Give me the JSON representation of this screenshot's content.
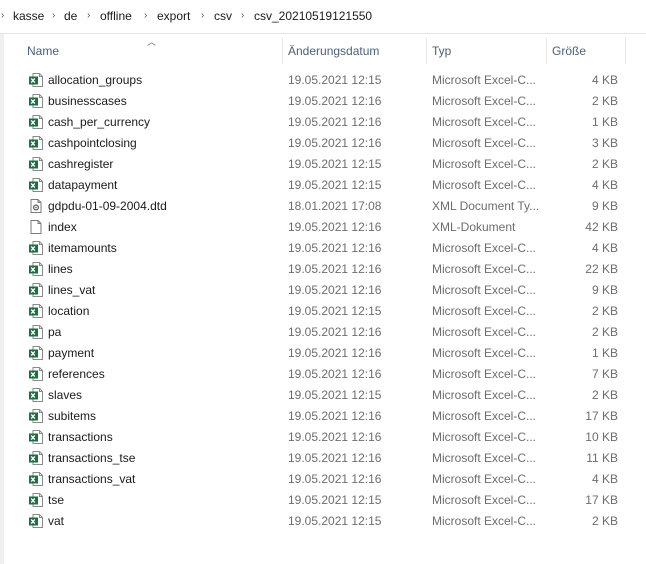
{
  "breadcrumb": [
    "kasse",
    "de",
    "offline",
    "export",
    "csv",
    "csv_20210519121550"
  ],
  "columns": {
    "name": "Name",
    "date": "Änderungsdatum",
    "type": "Typ",
    "size": "Größe"
  },
  "colors": {
    "excel_green": "#1d6f42",
    "header_text": "#4c607a",
    "secondary_text": "#6d6d6d"
  },
  "files": [
    {
      "name": "allocation_groups",
      "date": "19.05.2021 12:15",
      "type": "Microsoft Excel-C...",
      "size": "4 KB",
      "icon": "excel-csv-icon"
    },
    {
      "name": "businesscases",
      "date": "19.05.2021 12:16",
      "type": "Microsoft Excel-C...",
      "size": "2 KB",
      "icon": "excel-csv-icon"
    },
    {
      "name": "cash_per_currency",
      "date": "19.05.2021 12:16",
      "type": "Microsoft Excel-C...",
      "size": "1 KB",
      "icon": "excel-csv-icon"
    },
    {
      "name": "cashpointclosing",
      "date": "19.05.2021 12:16",
      "type": "Microsoft Excel-C...",
      "size": "3 KB",
      "icon": "excel-csv-icon"
    },
    {
      "name": "cashregister",
      "date": "19.05.2021 12:15",
      "type": "Microsoft Excel-C...",
      "size": "2 KB",
      "icon": "excel-csv-icon"
    },
    {
      "name": "datapayment",
      "date": "19.05.2021 12:15",
      "type": "Microsoft Excel-C...",
      "size": "4 KB",
      "icon": "excel-csv-icon"
    },
    {
      "name": "gdpdu-01-09-2004.dtd",
      "date": "18.01.2021 17:08",
      "type": "XML Document Ty...",
      "size": "9 KB",
      "icon": "dtd-file-icon"
    },
    {
      "name": "index",
      "date": "19.05.2021 12:16",
      "type": "XML-Dokument",
      "size": "42 KB",
      "icon": "blank-file-icon"
    },
    {
      "name": "itemamounts",
      "date": "19.05.2021 12:16",
      "type": "Microsoft Excel-C...",
      "size": "4 KB",
      "icon": "excel-csv-icon"
    },
    {
      "name": "lines",
      "date": "19.05.2021 12:16",
      "type": "Microsoft Excel-C...",
      "size": "22 KB",
      "icon": "excel-csv-icon"
    },
    {
      "name": "lines_vat",
      "date": "19.05.2021 12:16",
      "type": "Microsoft Excel-C...",
      "size": "9 KB",
      "icon": "excel-csv-icon"
    },
    {
      "name": "location",
      "date": "19.05.2021 12:15",
      "type": "Microsoft Excel-C...",
      "size": "2 KB",
      "icon": "excel-csv-icon"
    },
    {
      "name": "pa",
      "date": "19.05.2021 12:16",
      "type": "Microsoft Excel-C...",
      "size": "2 KB",
      "icon": "excel-csv-icon"
    },
    {
      "name": "payment",
      "date": "19.05.2021 12:16",
      "type": "Microsoft Excel-C...",
      "size": "1 KB",
      "icon": "excel-csv-icon"
    },
    {
      "name": "references",
      "date": "19.05.2021 12:16",
      "type": "Microsoft Excel-C...",
      "size": "7 KB",
      "icon": "excel-csv-icon"
    },
    {
      "name": "slaves",
      "date": "19.05.2021 12:15",
      "type": "Microsoft Excel-C...",
      "size": "2 KB",
      "icon": "excel-csv-icon"
    },
    {
      "name": "subitems",
      "date": "19.05.2021 12:16",
      "type": "Microsoft Excel-C...",
      "size": "17 KB",
      "icon": "excel-csv-icon"
    },
    {
      "name": "transactions",
      "date": "19.05.2021 12:16",
      "type": "Microsoft Excel-C...",
      "size": "10 KB",
      "icon": "excel-csv-icon"
    },
    {
      "name": "transactions_tse",
      "date": "19.05.2021 12:16",
      "type": "Microsoft Excel-C...",
      "size": "11 KB",
      "icon": "excel-csv-icon"
    },
    {
      "name": "transactions_vat",
      "date": "19.05.2021 12:16",
      "type": "Microsoft Excel-C...",
      "size": "4 KB",
      "icon": "excel-csv-icon"
    },
    {
      "name": "tse",
      "date": "19.05.2021 12:15",
      "type": "Microsoft Excel-C...",
      "size": "17 KB",
      "icon": "excel-csv-icon"
    },
    {
      "name": "vat",
      "date": "19.05.2021 12:15",
      "type": "Microsoft Excel-C...",
      "size": "2 KB",
      "icon": "excel-csv-icon"
    }
  ]
}
